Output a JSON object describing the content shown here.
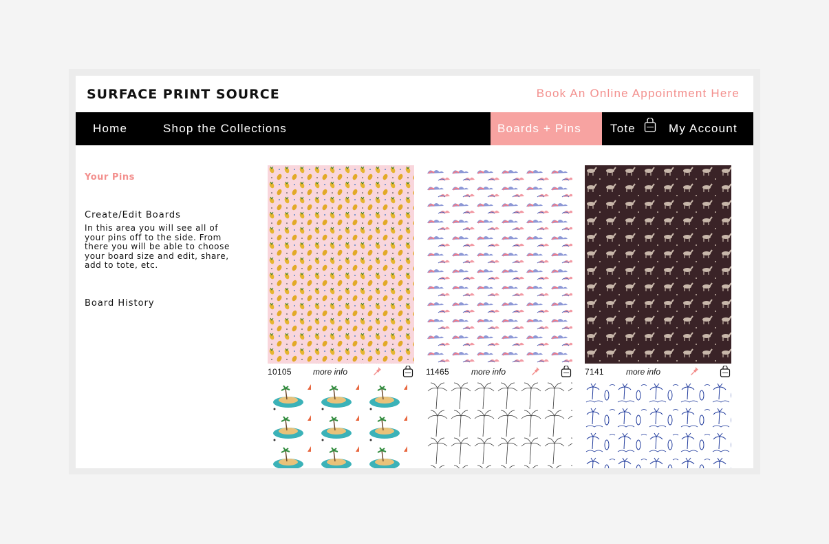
{
  "header": {
    "brand": "SURFACE PRINT SOURCE",
    "appointment_link": "Book An Online Appointment Here"
  },
  "nav": {
    "home": "Home",
    "shop": "Shop the Collections",
    "boards_pins": "Boards + Pins",
    "tote": "Tote",
    "account": "My Account"
  },
  "sidebar": {
    "your_pins": "Your Pins",
    "create_edit": "Create/Edit Boards",
    "description": "In this area you will see all of your pins off to the side. From there you will be able to choose your board size and edit, share, add to tote, etc.",
    "board_history": "Board History"
  },
  "prints": [
    {
      "sku": "10105",
      "more": "more info"
    },
    {
      "sku": "11465",
      "more": "more info"
    },
    {
      "sku": "7141",
      "more": "more info"
    }
  ],
  "colors": {
    "accent": "#f3908e",
    "nav_active": "#f7a3a1",
    "nav_bg": "#000000"
  }
}
